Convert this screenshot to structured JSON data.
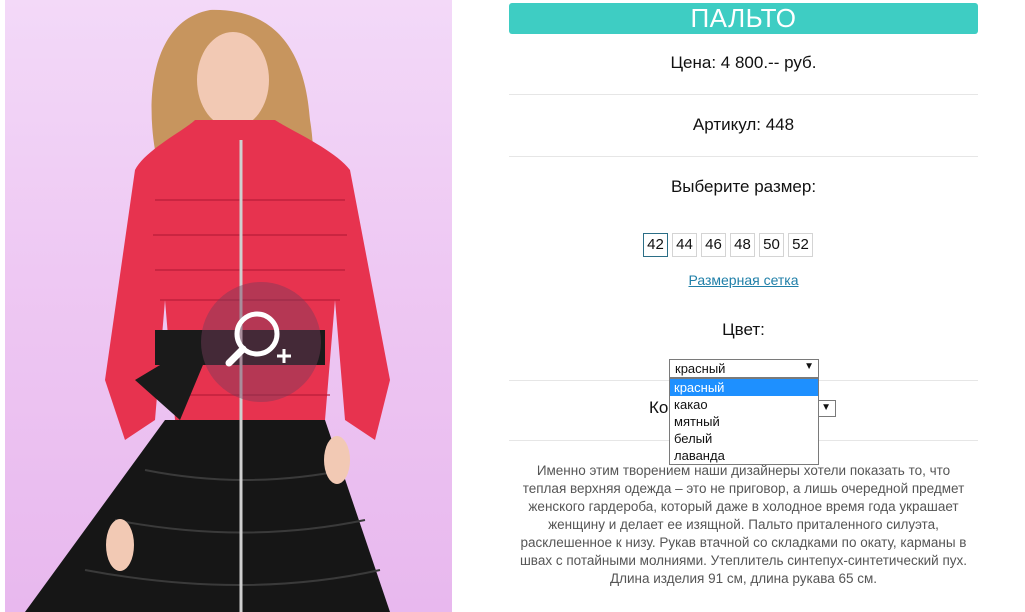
{
  "product": {
    "title": "ПАЛЬТО",
    "price": "Цена: 4 800.-- руб.",
    "article": "Артикул: 448",
    "size_prompt": "Выберите размер:",
    "sizes": [
      "42",
      "44",
      "46",
      "48",
      "50",
      "52"
    ],
    "selected_size": "42",
    "size_chart_link": "Размерная сетка",
    "color_label": "Цвет:",
    "color_selected": "красный",
    "color_options": [
      "красный",
      "какао",
      "мятный",
      "белый",
      "лаванда"
    ],
    "quantity_label_visible": "Ко",
    "description": "Именно этим творением наши дизайнеры хотели показать то, что теплая верхняя одежда – это не приговор, а лишь очередной предмет женского гардероба, который даже в холодное время года украшает женщину и делает ее изящной. Пальто приталенного силуэта, расклешенное к низу. Рукав втачной со складками по окату, карманы в швах с потайными молниями. Утеплитель синтепух-синтетический пух. Длина изделия 91 см, длина рукава 65 см."
  },
  "colors": {
    "accent": "#3ecdc3",
    "link": "#1f7fa8",
    "dropdown_highlight": "#1e90ff"
  },
  "icons": {
    "zoom": "magnifier-plus-icon",
    "dropdown": "triangle-down-icon"
  }
}
